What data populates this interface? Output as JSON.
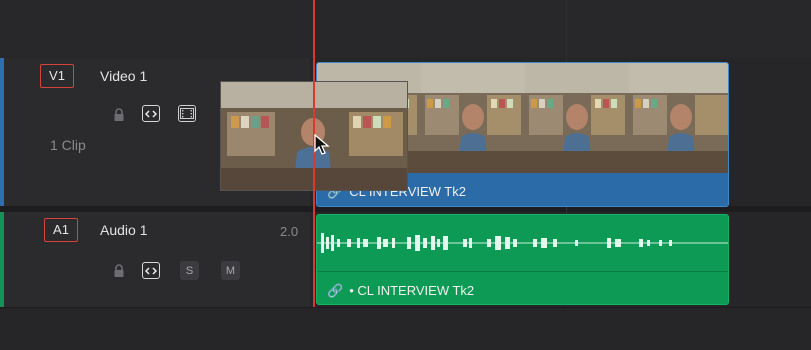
{
  "video_track": {
    "tag": "V1",
    "name": "Video 1",
    "clip_count": "1 Clip",
    "color": "#2f6fb0",
    "icons": [
      "lock-icon",
      "auto-select-icon",
      "film-icon"
    ]
  },
  "audio_track": {
    "tag": "A1",
    "name": "Audio 1",
    "channel": "2.0",
    "color": "#16915a",
    "solo_label": "S",
    "mute_label": "M",
    "icons": [
      "lock-icon",
      "auto-select-icon"
    ]
  },
  "video_clip": {
    "label": "CL INTERVIEW Tk2",
    "color": "#2b6ca8"
  },
  "audio_clip": {
    "label": "• CL INTERVIEW Tk2",
    "color": "#0d9a55"
  },
  "playhead_color": "#d9392f"
}
